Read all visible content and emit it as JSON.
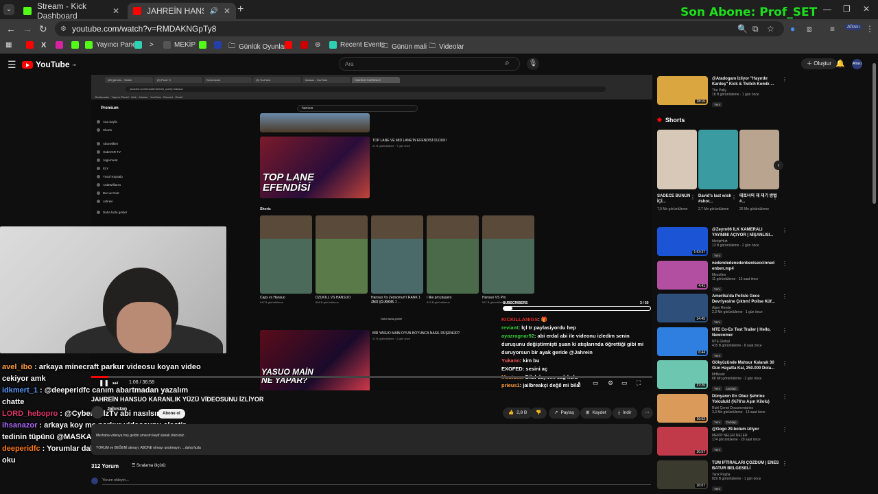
{
  "overlay": {
    "title": "Son Abone: Prof_SET"
  },
  "browser": {
    "tabs": [
      {
        "label": "Stream - Kick Dashboard"
      },
      {
        "label": "JAHREİN HANSUO KARANL"
      }
    ],
    "url": "youtube.com/watch?v=RMDAKNGpTy8",
    "bookmarks": [
      "Yayıncı Paneli",
      "MEKİP",
      "Günlük Oyunlar",
      "Recent Events",
      "Günün mali",
      "Videolar"
    ]
  },
  "youtube": {
    "logo": "YouTube",
    "logo_region": "TR",
    "search_placeholder": "Ara",
    "create_label": "Oluştur",
    "avatar_label": "Afraxı"
  },
  "inner": {
    "premium": "Premium",
    "search_text": "hansuo",
    "sidebar": [
      "Ana Sayfa",
      "Shorts",
      "Abonelikler",
      "HaberGR TV",
      "Jagermeat",
      "ELY",
      "Yusuf Kayaalp",
      "ArdaWilliams",
      "Bor ve Dost",
      "Jahrein",
      "Daha fazla göster"
    ],
    "video1": {
      "title": "TOP LANE VE MID LANE'IN EFENDİSİ OLDUK!",
      "meta": "21 B görüntüleme · 7 gün önce",
      "banner": "TOP LANE EFENDİSİ"
    },
    "shorts_label": "Shorts",
    "shorts": [
      {
        "title": "Caps vs Hansuo",
        "views": "947 B görüntüleme"
      },
      {
        "title": "DZUKILL VS HANSUO",
        "views": "968 B görüntüleme"
      },
      {
        "title": "Hansuo Vs Zedsomurf I RANK 1 ZED VS RANK 1 ...",
        "views": "105 B görüntüleme"
      },
      {
        "title": "I like pro players",
        "views": "815 B görüntüleme"
      },
      {
        "title": "Hansuo VS Pro",
        "views": "527 B görüntüleme"
      }
    ],
    "show_more": "Daha fazla göster",
    "video2": {
      "title": "BİR YASUO MAİN OYUN BOYUNCA NASIL DÜŞÜNÜR?",
      "meta": "21 B görüntüleme · 2 gün önce",
      "banner": "YASUO MAİN NE YAPAR?"
    },
    "subscribers_label": "SUBSCRIBERS",
    "subscribers_count": "3 / 50"
  },
  "chat_big": [
    {
      "user": "avel_ibo",
      "color": "#ff9e42",
      "text": ": arkaya minecraft parkur videosu koyan video"
    },
    {
      "user": "",
      "color": "#ffffff",
      "text": "cekiyor amk"
    },
    {
      "user": "idkmert_1",
      "color": "#5b9bff",
      "text": ": @deeperidfc canım abartmadan yazalım"
    },
    {
      "user": "",
      "color": "#ffffff",
      "text": "chatte"
    },
    {
      "user": "LORD_hebopro",
      "color": "#e0346a",
      "text": ": @CyberRulzTv abi nasılsın ?"
    },
    {
      "user": "ihsanazor",
      "color": "#b06bff",
      "text": ": arkaya koy mc parkur videosunu eleştir"
    },
    {
      "user": "",
      "color": "#ffffff",
      "text": "tedinin tüpünü @MASKAR"
    },
    {
      "user": "deeperidfc",
      "color": "#ff7a1a",
      "text": ": Yorumlar daha da komik sadece yorumları"
    },
    {
      "user": "",
      "color": "#ffffff",
      "text": "oku"
    }
  ],
  "chat_small": [
    {
      "user": "KICKILLANIGS",
      "color": "#e4322c",
      "text": ": 🎁"
    },
    {
      "user": "reviant",
      "color": "#3ad33a",
      "text": ": İçl tr paylasiyordu hep"
    },
    {
      "user": "ayazragnar92",
      "color": "#3ad33a",
      "text": ": abi erdal abi ile videonu izledim senin"
    },
    {
      "user": "",
      "color": "#ffffff",
      "text": "duruşunu değiştirmişti şuan ki atışlarında öğrettiği gibi mi"
    },
    {
      "user": "",
      "color": "#ffffff",
      "text": "duruyorsun bir ayak geride @Jahrein"
    },
    {
      "user": "Yukann",
      "color": "#ff5a5a",
      "text": ": kim bu"
    },
    {
      "user": "EXOFED",
      "color": "#ffffff",
      "text": ": sesini aç"
    },
    {
      "user": "Meatuss",
      "color": "#ff9e42",
      "text": ": Bilal dayının sağ kolu"
    },
    {
      "user": "prieus1",
      "color": "#ff9e42",
      "text": ": jailbreakçi değil mi bilal"
    }
  ],
  "player": {
    "timecode": "1:06 / 36:58",
    "progress_fraction": 0.03
  },
  "video": {
    "title": "JAHREİN HANSUO KARANLIK YÜZÜ VİDEOSUNU İZLİYOR",
    "channel": "Jahrstan",
    "subscribe": "Abone ol",
    "likes": "2,8 B",
    "share": "Paylaş",
    "save": "Kaydet",
    "download": "İndir",
    "desc1": "Merhaba videoya hoş geldin umarım keyif alarak izlersiniz.",
    "desc2": "YORUM ve BEĞENİ atmayı, ABONE olmayı unutmayın.  ...daha fazla",
    "comments_count": "312 Yorum",
    "sort_by": "Sıralama ölçütü:",
    "add_comment": "Yorum ekleyin..."
  },
  "right": {
    "top": {
      "title": "@Atadoganı İzliyor \"Hayırdır Kardeş\" Kick & Twitch Komik ...",
      "channel": "The Pally",
      "views": "18 B görüntüleme · 1 gün önce",
      "badge": "Yeni",
      "duration": "18:16",
      "color": "#d9a640"
    },
    "shorts_title": "Shorts",
    "shorts": [
      {
        "title": "SADECE BUNUN İÇİ...",
        "views": "7,9 Mn görüntüleme",
        "color": "#d8c8b8"
      },
      {
        "title": "David's last wish #shor...",
        "views": "2,7 Mn görüntüleme",
        "color": "#3a9ba0"
      },
      {
        "title": "테토녀의 재 재기 방법 #...",
        "views": "26 Mn görüntüleme",
        "color": "#b9a48f"
      }
    ],
    "videos": [
      {
        "title": "@Zeyrn06 İLK KAMERALI YAYININI AÇIYOR | NİŞANLISI...",
        "channel": "MekipHub",
        "views": "13 B görüntüleme · 2 gün önce",
        "badge": "Yeni",
        "duration": "1:53:37",
        "color": "#1b55d6"
      },
      {
        "title": "nedendedenedenbeniseccinned enben.mp4",
        "channel": "Mezofinn",
        "views": "11 görüntüleme · 13 saat önce",
        "badge": "Yeni",
        "duration": "4:41",
        "color": "#b24fa0"
      },
      {
        "title": "Amerika'da Polisle Gece Devriyesine Çıktım! Polise Küf...",
        "channel": "Alper Rende",
        "views": "2,3 Mn görüntüleme · 1 gün önce",
        "badge": "Yeni",
        "duration": "34:45",
        "color": "#2e4f7a"
      },
      {
        "title": "NTE Co-Ex Test Trailer | Hello, Newcomer",
        "channel": "NTE Global",
        "views": "415 B görüntüleme · 8 saat önce",
        "badge": "Yeni",
        "duration": "6:44",
        "color": "#2f7fe0"
      },
      {
        "title": "Gökyüzünde Mahsur Kalarak 30 Gün Hayatta Kal, 250.000 Dola...",
        "channel": "MrBeast",
        "views": "68 Mn görüntüleme · 2 gün önce",
        "badge": "Yeni",
        "badge2": "Dublajlı",
        "duration": "37:26",
        "color": "#6cc6b0"
      },
      {
        "title": "Dünyanın En Obez Şehrine Yolculuk! (%76'sı Aşırı Kilolu)",
        "channel": "Ruhi Çenet Documentaries",
        "views": "3,3 Mn görüntüleme · 13 saat önce",
        "badge": "Yeni",
        "badge2": "Dublajlı",
        "duration": "16:02",
        "color": "#d99a5a"
      },
      {
        "title": "@Gogo 29.bolum izliyor",
        "channel": "MEKİP NELER NELER",
        "views": "174 görüntüleme · 20 saat önce",
        "badge": "Yeni",
        "duration": "20:57",
        "color": "#c13a4a"
      },
      {
        "title": "TÜM İFTİRALARI ÇÖZDÜM | ENES BATUR BELGESELİ",
        "channel": "Tarık Paşha",
        "views": "829 B görüntüleme · 1 gün önce",
        "badge": "Yeni",
        "duration": "26:07",
        "color": "#3a3a2e"
      }
    ]
  }
}
